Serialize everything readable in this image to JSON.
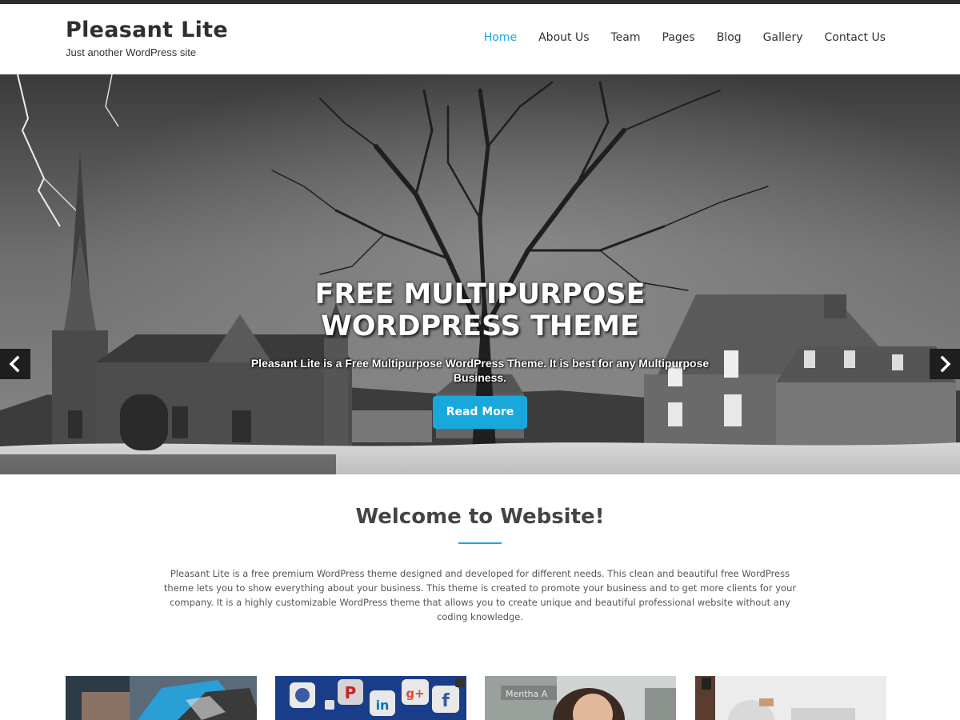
{
  "site": {
    "title": "Pleasant Lite",
    "tagline": "Just another WordPress site"
  },
  "nav": {
    "items": [
      "Home",
      "About Us",
      "Team",
      "Pages",
      "Blog",
      "Gallery",
      "Contact Us"
    ],
    "active": "Home"
  },
  "hero": {
    "title_line1": "FREE MULTIPURPOSE",
    "title_line2": "WORDPRESS THEME",
    "text": "Pleasant Lite is a Free Multipurpose WordPress Theme. It is best for any Multipurpose Business.",
    "button": "Read More",
    "slide_count": 3,
    "active_slide": 1
  },
  "welcome": {
    "title": "Welcome to Website!",
    "text": "Pleasant Lite is a free premium WordPress theme designed and developed for different needs. This clean and beautiful free WordPress theme lets you to show everything about your business. This theme is created to promote your business and to get more clients for your company. It is a highly customizable WordPress theme that allows you to create unique and beautiful professional website without any coding knowledge."
  },
  "colors": {
    "accent": "#1aa8dc",
    "topbar": "#2b2b2b",
    "text": "#444444"
  },
  "icons": {
    "prev": "chevron-left-icon",
    "next": "chevron-right-icon"
  }
}
